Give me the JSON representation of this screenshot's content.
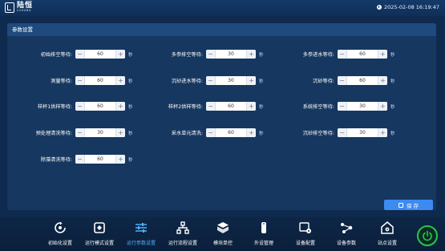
{
  "app": {
    "logo_cn": "陆恒",
    "logo_en": "LOHANG",
    "datetime": "2025-02-08 16:19:47"
  },
  "panel": {
    "title": "参数设置"
  },
  "params": [
    {
      "label": "初始排空等待:",
      "value": "60",
      "unit": "秒"
    },
    {
      "label": "多参排空等待:",
      "value": "30",
      "unit": "秒"
    },
    {
      "label": "多参进水等待:",
      "value": "60",
      "unit": "秒"
    },
    {
      "label": "测量等待:",
      "value": "60",
      "unit": "秒"
    },
    {
      "label": "沉砂进水等待:",
      "value": "30",
      "unit": "秒"
    },
    {
      "label": "沉砂等待:",
      "value": "60",
      "unit": "秒"
    },
    {
      "label": "样杯1供样等待:",
      "value": "60",
      "unit": "秒"
    },
    {
      "label": "样杯2供样等待:",
      "value": "60",
      "unit": "秒"
    },
    {
      "label": "系统排空等待:",
      "value": "30",
      "unit": "秒"
    },
    {
      "label": "预处理清洗等待:",
      "value": "30",
      "unit": "秒"
    },
    {
      "label": "采水单元清洗:",
      "value": "60",
      "unit": "秒"
    },
    {
      "label": "沉砂排空等待:",
      "value": "30",
      "unit": "秒"
    },
    {
      "label": "除藻清洗等待:",
      "value": "60",
      "unit": "秒"
    }
  ],
  "stepper": {
    "minus": "−",
    "plus": "+"
  },
  "save": {
    "label": "保 存"
  },
  "nav": [
    {
      "label": "初始化设置",
      "icon": "init-icon",
      "active": false
    },
    {
      "label": "运行模式设置",
      "icon": "mode-icon",
      "active": false
    },
    {
      "label": "运行参数设置",
      "icon": "sliders-icon",
      "active": true
    },
    {
      "label": "运行流程设置",
      "icon": "flow-icon",
      "active": false
    },
    {
      "label": "模块单控",
      "icon": "cube-icon",
      "active": false
    },
    {
      "label": "外设管理",
      "icon": "device-icon",
      "active": false
    },
    {
      "label": "设备配置",
      "icon": "config-icon",
      "active": false
    },
    {
      "label": "设备参数",
      "icon": "nodes-icon",
      "active": false
    },
    {
      "label": "站点设置",
      "icon": "home-gear-icon",
      "active": false
    }
  ],
  "colors": {
    "accent": "#3d8bf0",
    "active_nav": "#4fb0ff",
    "power": "#28c54f"
  }
}
